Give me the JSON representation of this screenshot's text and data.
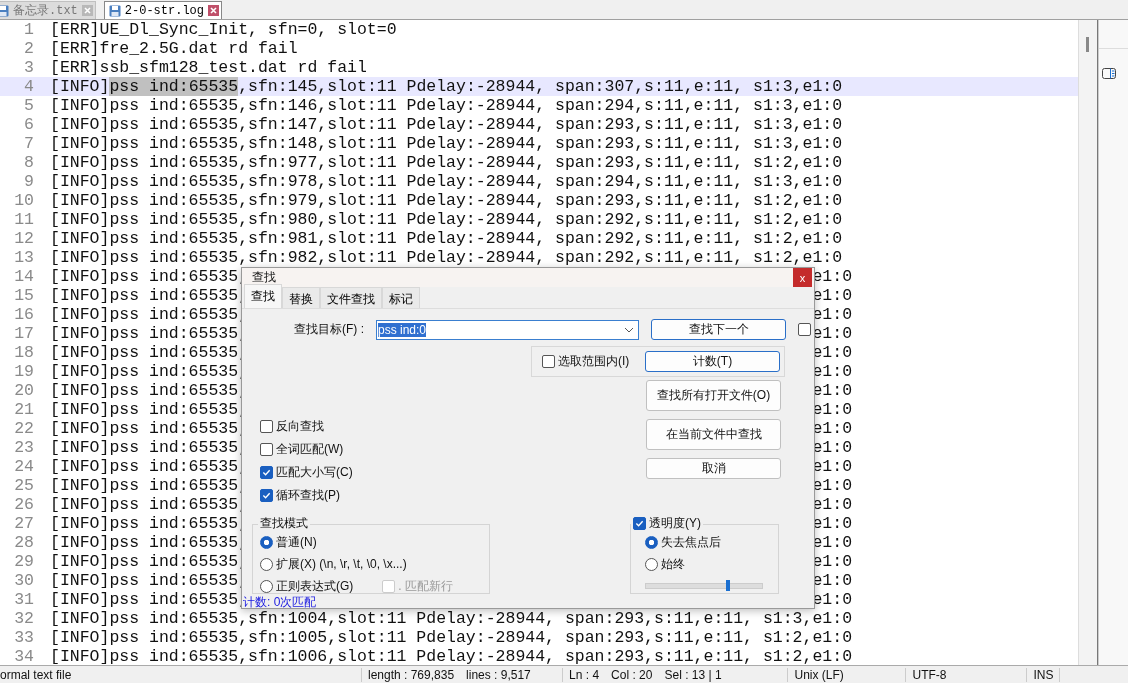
{
  "tabs": [
    {
      "label": "备忘录.txt",
      "selected": false
    },
    {
      "label": "2-0-str.log",
      "selected": true
    }
  ],
  "editor": {
    "lines": [
      {
        "kind": "plain",
        "num": "1",
        "text": "[ERR]UE_Dl_Sync_Init, sfn=0, slot=0"
      },
      {
        "kind": "plain",
        "num": "2",
        "text": "[ERR]fre_2.5G.dat rd fail"
      },
      {
        "kind": "plain",
        "num": "3",
        "text": "[ERR]ssb_sfm128_test.dat rd fail"
      },
      {
        "kind": "current",
        "num": "4",
        "before": "[INFO]",
        "selection": "pss ind:65535",
        "after": ",sfn:145,slot:11 Pdelay:-28944, span:307,s:11,e:11, s1:3,e1:0"
      },
      {
        "kind": "plain",
        "num": "5",
        "text": "[INFO]pss ind:65535,sfn:146,slot:11 Pdelay:-28944, span:294,s:11,e:11, s1:3,e1:0"
      },
      {
        "kind": "plain",
        "num": "6",
        "text": "[INFO]pss ind:65535,sfn:147,slot:11 Pdelay:-28944, span:293,s:11,e:11, s1:3,e1:0"
      },
      {
        "kind": "plain",
        "num": "7",
        "text": "[INFO]pss ind:65535,sfn:148,slot:11 Pdelay:-28944, span:293,s:11,e:11, s1:3,e1:0"
      },
      {
        "kind": "plain",
        "num": "8",
        "text": "[INFO]pss ind:65535,sfn:977,slot:11 Pdelay:-28944, span:293,s:11,e:11, s1:2,e1:0"
      },
      {
        "kind": "plain",
        "num": "9",
        "text": "[INFO]pss ind:65535,sfn:978,slot:11 Pdelay:-28944, span:294,s:11,e:11, s1:3,e1:0"
      },
      {
        "kind": "plain",
        "num": "10",
        "text": "[INFO]pss ind:65535,sfn:979,slot:11 Pdelay:-28944, span:293,s:11,e:11, s1:2,e1:0"
      },
      {
        "kind": "plain",
        "num": "11",
        "text": "[INFO]pss ind:65535,sfn:980,slot:11 Pdelay:-28944, span:292,s:11,e:11, s1:2,e1:0"
      },
      {
        "kind": "plain",
        "num": "12",
        "text": "[INFO]pss ind:65535,sfn:981,slot:11 Pdelay:-28944, span:292,s:11,e:11, s1:2,e1:0"
      },
      {
        "kind": "plain",
        "num": "13",
        "text": "[INFO]pss ind:65535,sfn:982,slot:11 Pdelay:-28944, span:292,s:11,e:11, s1:2,e1:0"
      },
      {
        "kind": "split",
        "num": "14",
        "left": "[INFO]pss ind:65535,",
        "right": "e1:0"
      },
      {
        "kind": "split",
        "num": "15",
        "left": "[INFO]pss ind:65535,",
        "right": "e1:0"
      },
      {
        "kind": "split",
        "num": "16",
        "left": "[INFO]pss ind:65535,",
        "right": "e1:0"
      },
      {
        "kind": "split",
        "num": "17",
        "left": "[INFO]pss ind:65535,",
        "right": "e1:0"
      },
      {
        "kind": "split",
        "num": "18",
        "left": "[INFO]pss ind:65535,",
        "right": "e1:0"
      },
      {
        "kind": "split",
        "num": "19",
        "left": "[INFO]pss ind:65535,",
        "right": "e1:0"
      },
      {
        "kind": "split",
        "num": "20",
        "left": "[INFO]pss ind:65535,",
        "right": "e1:0"
      },
      {
        "kind": "split",
        "num": "21",
        "left": "[INFO]pss ind:65535,",
        "right": "e1:0"
      },
      {
        "kind": "split",
        "num": "22",
        "left": "[INFO]pss ind:65535,",
        "right": "e1:0"
      },
      {
        "kind": "split",
        "num": "23",
        "left": "[INFO]pss ind:65535,",
        "right": "e1:0"
      },
      {
        "kind": "split",
        "num": "24",
        "left": "[INFO]pss ind:65535,",
        "right": "e1:0"
      },
      {
        "kind": "split",
        "num": "25",
        "left": "[INFO]pss ind:65535,",
        "right": "e1:0"
      },
      {
        "kind": "split",
        "num": "26",
        "left": "[INFO]pss ind:65535,",
        "right": "e1:0"
      },
      {
        "kind": "split",
        "num": "27",
        "left": "[INFO]pss ind:65535,",
        "right": "e1:0"
      },
      {
        "kind": "split",
        "num": "28",
        "left": "[INFO]pss ind:65535,",
        "right": "e1:0"
      },
      {
        "kind": "split",
        "num": "29",
        "left": "[INFO]pss ind:65535,",
        "right": "e1:0"
      },
      {
        "kind": "split",
        "num": "30",
        "left": "[INFO]pss ind:65535,",
        "right": "e1:0"
      },
      {
        "kind": "split",
        "num": "31",
        "left": "[INFO]pss ind:65535,",
        "right": "e1:0"
      },
      {
        "kind": "plain",
        "num": "32",
        "text": "[INFO]pss ind:65535,sfn:1004,slot:11 Pdelay:-28944, span:293,s:11,e:11, s1:3,e1:0"
      },
      {
        "kind": "plain",
        "num": "33",
        "text": "[INFO]pss ind:65535,sfn:1005,slot:11 Pdelay:-28944, span:293,s:11,e:11, s1:2,e1:0"
      },
      {
        "kind": "plain",
        "num": "34",
        "text": "[INFO]pss ind:65535,sfn:1006,slot:11 Pdelay:-28944, span:293,s:11,e:11, s1:2,e1:0"
      }
    ]
  },
  "dialog": {
    "title": "查找",
    "close": "x",
    "tabs": [
      {
        "label": "查找",
        "selected": true
      },
      {
        "label": "替换",
        "selected": false
      },
      {
        "label": "文件查找",
        "selected": false
      },
      {
        "label": "标记",
        "selected": false
      }
    ],
    "find_label": "查找目标(F) :",
    "find_value": "pss ind:0",
    "extra_checkbox": {
      "checked": false
    },
    "in_selection": {
      "label": "选取范围内(I)",
      "checked": false
    },
    "buttons": [
      "查找下一个",
      "计数(T)",
      "查找所有打开文件(O)",
      "在当前文件中查找",
      "取消"
    ],
    "options": [
      {
        "label": "反向查找",
        "checked": false
      },
      {
        "label": "全词匹配(W)",
        "checked": false
      },
      {
        "label": "匹配大小写(C)",
        "checked": true
      },
      {
        "label": "循环查找(P)",
        "checked": true
      }
    ],
    "search_mode": {
      "title": "查找模式",
      "options": [
        {
          "label": "普通(N)",
          "selected": true
        },
        {
          "label": "扩展(X) (\\n, \\r, \\t, \\0, \\x...)",
          "selected": false
        },
        {
          "label": "正则表达式(G)",
          "selected": false
        }
      ],
      "newline": {
        "label": ". 匹配新行",
        "checked": false,
        "disabled": true
      }
    },
    "transparency": {
      "label": "透明度(Y)",
      "checked": true,
      "options": [
        {
          "label": "失去焦点后",
          "selected": true
        },
        {
          "label": "始终",
          "selected": false
        }
      ],
      "level": 0.71
    },
    "status": "计数: 0次匹配"
  },
  "status_bar": [
    "ormal text file",
    "length : 769,835",
    "lines : 9,517",
    "Ln : 4",
    "Col : 20",
    "Sel : 13 | 1",
    "Unix (LF)",
    "UTF-8",
    "INS"
  ]
}
